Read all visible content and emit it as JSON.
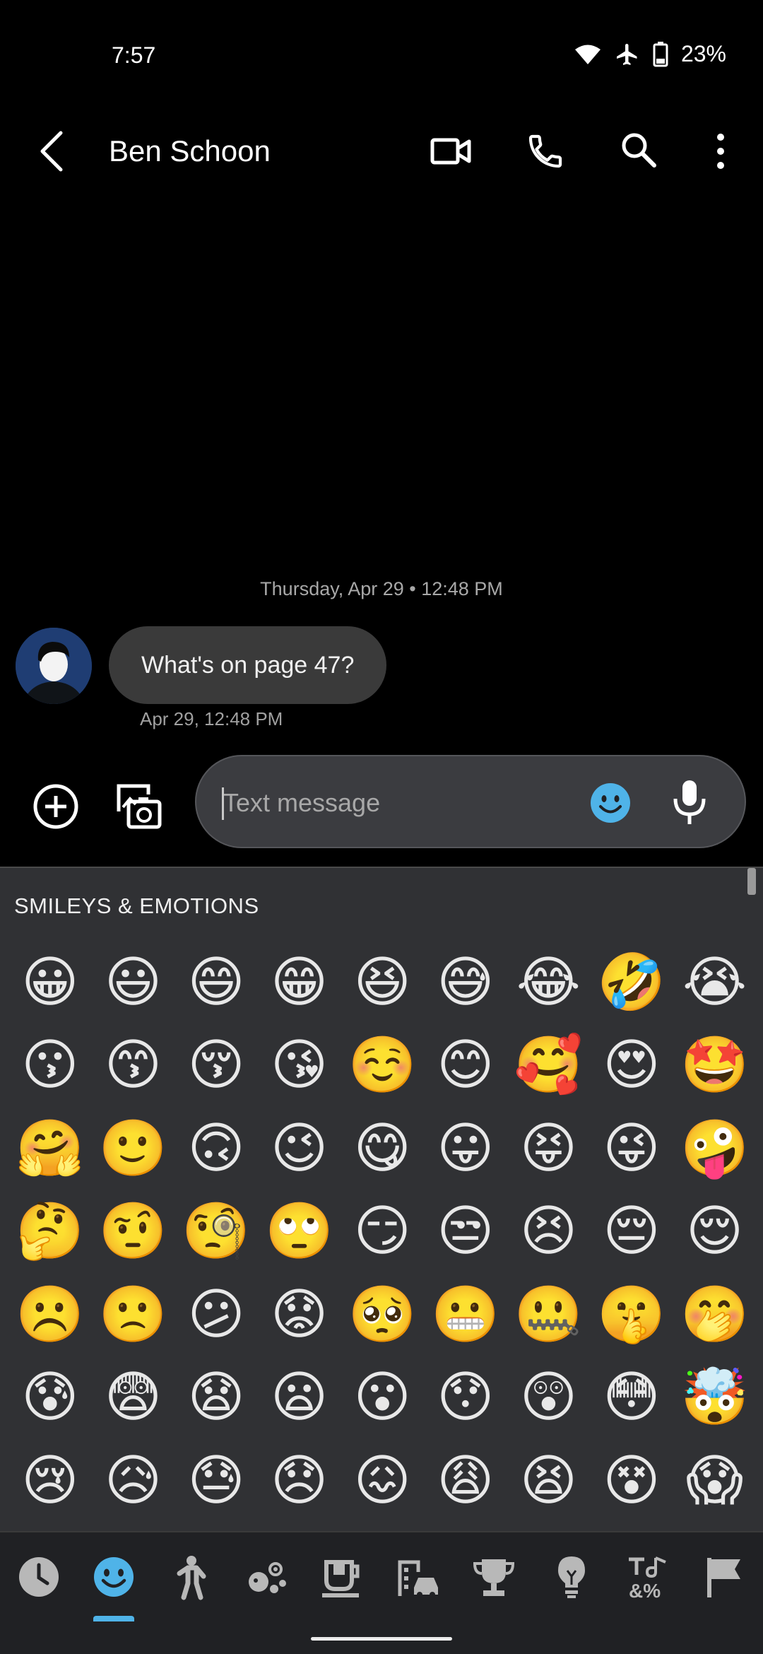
{
  "status_bar": {
    "time": "7:57",
    "battery": "23%"
  },
  "header": {
    "contact_name": "Ben Schoon"
  },
  "conversation": {
    "date_divider": "Thursday, Apr 29 • 12:48 PM",
    "messages": [
      {
        "text": "What's on page 47?",
        "time": "Apr 29, 12:48 PM"
      }
    ]
  },
  "compose": {
    "placeholder": "Text message"
  },
  "emoji_panel": {
    "category_title": "SMILEYS & EMOTIONS",
    "emojis": [
      "😀",
      "😃",
      "😄",
      "😁",
      "😆",
      "😅",
      "😂",
      "🤣",
      "😭",
      "😗",
      "😙",
      "😚",
      "😘",
      "☺️",
      "😊",
      "🥰",
      "😍",
      "🤩",
      "🤗",
      "🙂",
      "🙃",
      "😉",
      "😋",
      "😛",
      "😝",
      "😜",
      "🤪",
      "🤔",
      "🤨",
      "🧐",
      "🙄",
      "😏",
      "😒",
      "😣",
      "😔",
      "😌",
      "☹️",
      "🙁",
      "😕",
      "😟",
      "🥺",
      "😬",
      "🤐",
      "🤫",
      "🤭",
      "😰",
      "😨",
      "😧",
      "😦",
      "😮",
      "😯",
      "😲",
      "😳",
      "🤯",
      "😢",
      "😥",
      "😓",
      "😞",
      "😖",
      "😩",
      "😫",
      "😵",
      "😱"
    ],
    "tabs": [
      "recent-icon",
      "smileys-icon",
      "people-icon",
      "animals-icon",
      "food-icon",
      "travel-icon",
      "activities-icon",
      "objects-icon",
      "symbols-icon",
      "flags-icon"
    ],
    "selected_tab": "smileys-icon"
  },
  "colors": {
    "background": "#000000",
    "bubble": "#3a3a3a",
    "compose_box": "#3b3c40",
    "panel": "#303134",
    "accent": "#4fb3e8"
  }
}
